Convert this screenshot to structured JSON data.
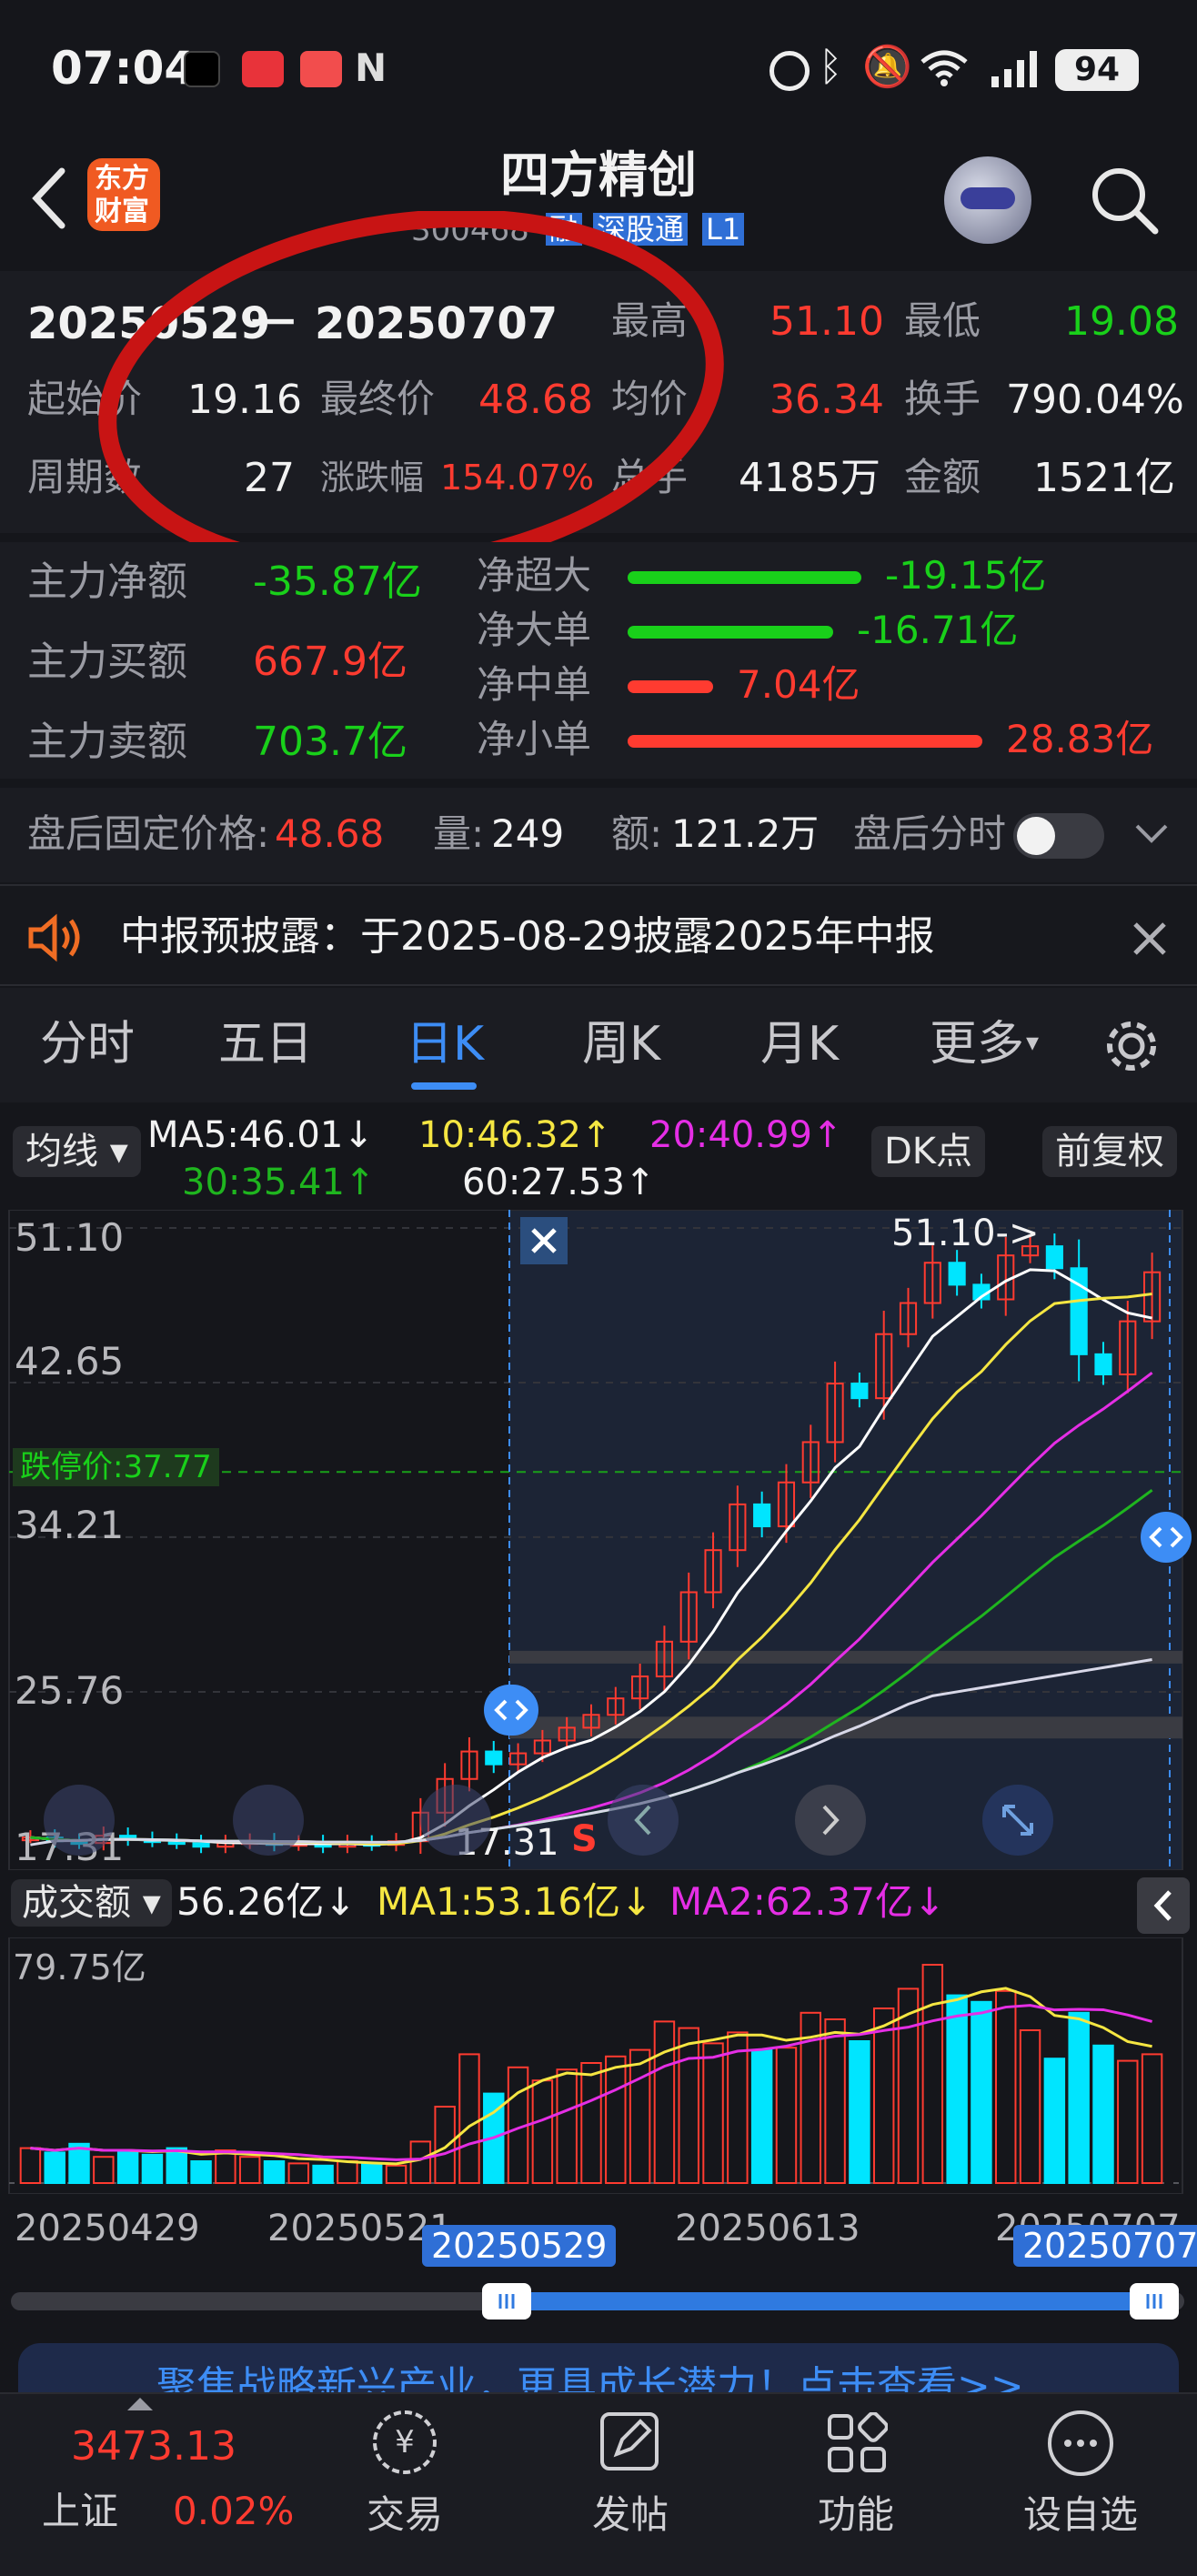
{
  "status": {
    "time": "07:04",
    "battery": "94",
    "signal": "signal-bars"
  },
  "header": {
    "title": "四方精创",
    "code": "300468",
    "tags": [
      "融",
      "深股通",
      "L1"
    ],
    "logo_line1": "东方",
    "logo_line2": "财富"
  },
  "summary": {
    "range_start": "20250529",
    "range_sep": "一",
    "range_end": "20250707",
    "high_label": "最高",
    "high": "51.10",
    "low_label": "最低",
    "low": "19.08",
    "start_label": "起始价",
    "start": "19.16",
    "final_label": "最终价",
    "final": "48.68",
    "avg_label": "均价",
    "avg": "36.34",
    "turn_label": "换手",
    "turn": "790.04%",
    "period_label": "周期数",
    "period": "27",
    "change_label": "涨跌幅",
    "change": "154.07%",
    "vol_label": "总手",
    "vol": "4185万",
    "amt_label": "金额",
    "amt": "1521亿"
  },
  "flows": {
    "net_label": "主力净额",
    "net": "-35.87亿",
    "buy_label": "主力买额",
    "buy": "667.9亿",
    "sell_label": "主力卖额",
    "sell": "703.7亿",
    "items": [
      {
        "label": "净超大",
        "value": "-19.15亿",
        "color": "#19d01a",
        "ratio": 0.66
      },
      {
        "label": "净大单",
        "value": "-16.71亿",
        "color": "#19d01a",
        "ratio": 0.58
      },
      {
        "label": "净中单",
        "value": "7.04亿",
        "color": "#ff3b30",
        "ratio": 0.24
      },
      {
        "label": "净小单",
        "value": "28.83亿",
        "color": "#ff3b30",
        "ratio": 1.0
      }
    ]
  },
  "afterhours": {
    "price_label": "盘后固定价格:",
    "price": "48.68",
    "vol_label": "量:",
    "vol": "249",
    "amt_label": "额:",
    "amt": "121.2万",
    "toggle_label": "盘后分时"
  },
  "notice": {
    "text": "中报预披露：于2025-08-29披露2025年中报"
  },
  "tabs": [
    "分时",
    "五日",
    "日K",
    "周K",
    "月K",
    "更多"
  ],
  "active_tab": 2,
  "ma": {
    "btn": "均线",
    "ma5": "MA5:46.01↓",
    "ma10": "10:46.32↑",
    "ma20": "20:40.99↑",
    "ma30": "30:35.41↑",
    "ma60": "60:27.53↑",
    "dk": "DK点",
    "fq": "前复权"
  },
  "axis": {
    "y1": "51.10",
    "y2": "42.65",
    "y3": "34.21",
    "y4": "25.76",
    "y5": "17.31",
    "limit": "跌停价:37.77",
    "hi_note": "51.10->",
    "lo_note": "17.31",
    "s_mark": "S"
  },
  "volume": {
    "btn": "成交额",
    "val": "56.26亿↓",
    "ma1": "MA1:53.16亿↓",
    "ma2": "MA2:62.37亿↓",
    "ymax": "79.75亿"
  },
  "dates": {
    "d1": "20250429",
    "d2": "20250521",
    "d3": "20250613",
    "d4": "20250707",
    "sel1": "20250529",
    "sel2": "20250707"
  },
  "banner": {
    "text": "聚焦战略新兴产业，更具成长潜力！点击查看>>"
  },
  "nav": {
    "index_value": "3473.13",
    "index_name": "上证",
    "index_change": "0.02%",
    "trade": "交易",
    "post": "发帖",
    "func": "功能",
    "watch": "设自选"
  },
  "colors": {
    "up": "#ff3b30",
    "down": "#00e5ff",
    "accent": "#3d8df5",
    "ma5": "#ffffff",
    "ma10": "#f5e642",
    "ma20": "#e52ee5",
    "ma30": "#1fb51f",
    "ma60": "#ffffff",
    "ring": "#d51920"
  },
  "chart_data": {
    "type": "candlestick",
    "title": "",
    "ylim": [
      17.31,
      51.1
    ],
    "x_labels": [
      "20250429",
      "20250521",
      "20250613",
      "20250707"
    ],
    "candles_approx_close": [
      17.8,
      17.6,
      17.5,
      17.9,
      17.7,
      17.6,
      17.5,
      17.3,
      17.5,
      17.6,
      17.4,
      17.5,
      17.3,
      17.5,
      17.4,
      17.6,
      19.16,
      21.0,
      22.5,
      21.8,
      22.4,
      23.1,
      23.8,
      24.5,
      25.4,
      26.6,
      28.5,
      31.2,
      33.5,
      36.0,
      34.8,
      37.2,
      39.4,
      42.6,
      41.8,
      45.3,
      47.0,
      49.2,
      48.0,
      47.2,
      49.6,
      50.1,
      48.9,
      44.2,
      43.1,
      46.0,
      48.68
    ],
    "volume_ratio": [
      0.16,
      0.14,
      0.18,
      0.12,
      0.15,
      0.13,
      0.16,
      0.1,
      0.15,
      0.12,
      0.1,
      0.09,
      0.08,
      0.1,
      0.09,
      0.08,
      0.19,
      0.35,
      0.59,
      0.41,
      0.53,
      0.47,
      0.52,
      0.55,
      0.58,
      0.61,
      0.74,
      0.71,
      0.64,
      0.69,
      0.61,
      0.62,
      0.78,
      0.75,
      0.65,
      0.8,
      0.89,
      1.0,
      0.86,
      0.83,
      0.88,
      0.7,
      0.57,
      0.78,
      0.63,
      0.56,
      0.59
    ]
  }
}
